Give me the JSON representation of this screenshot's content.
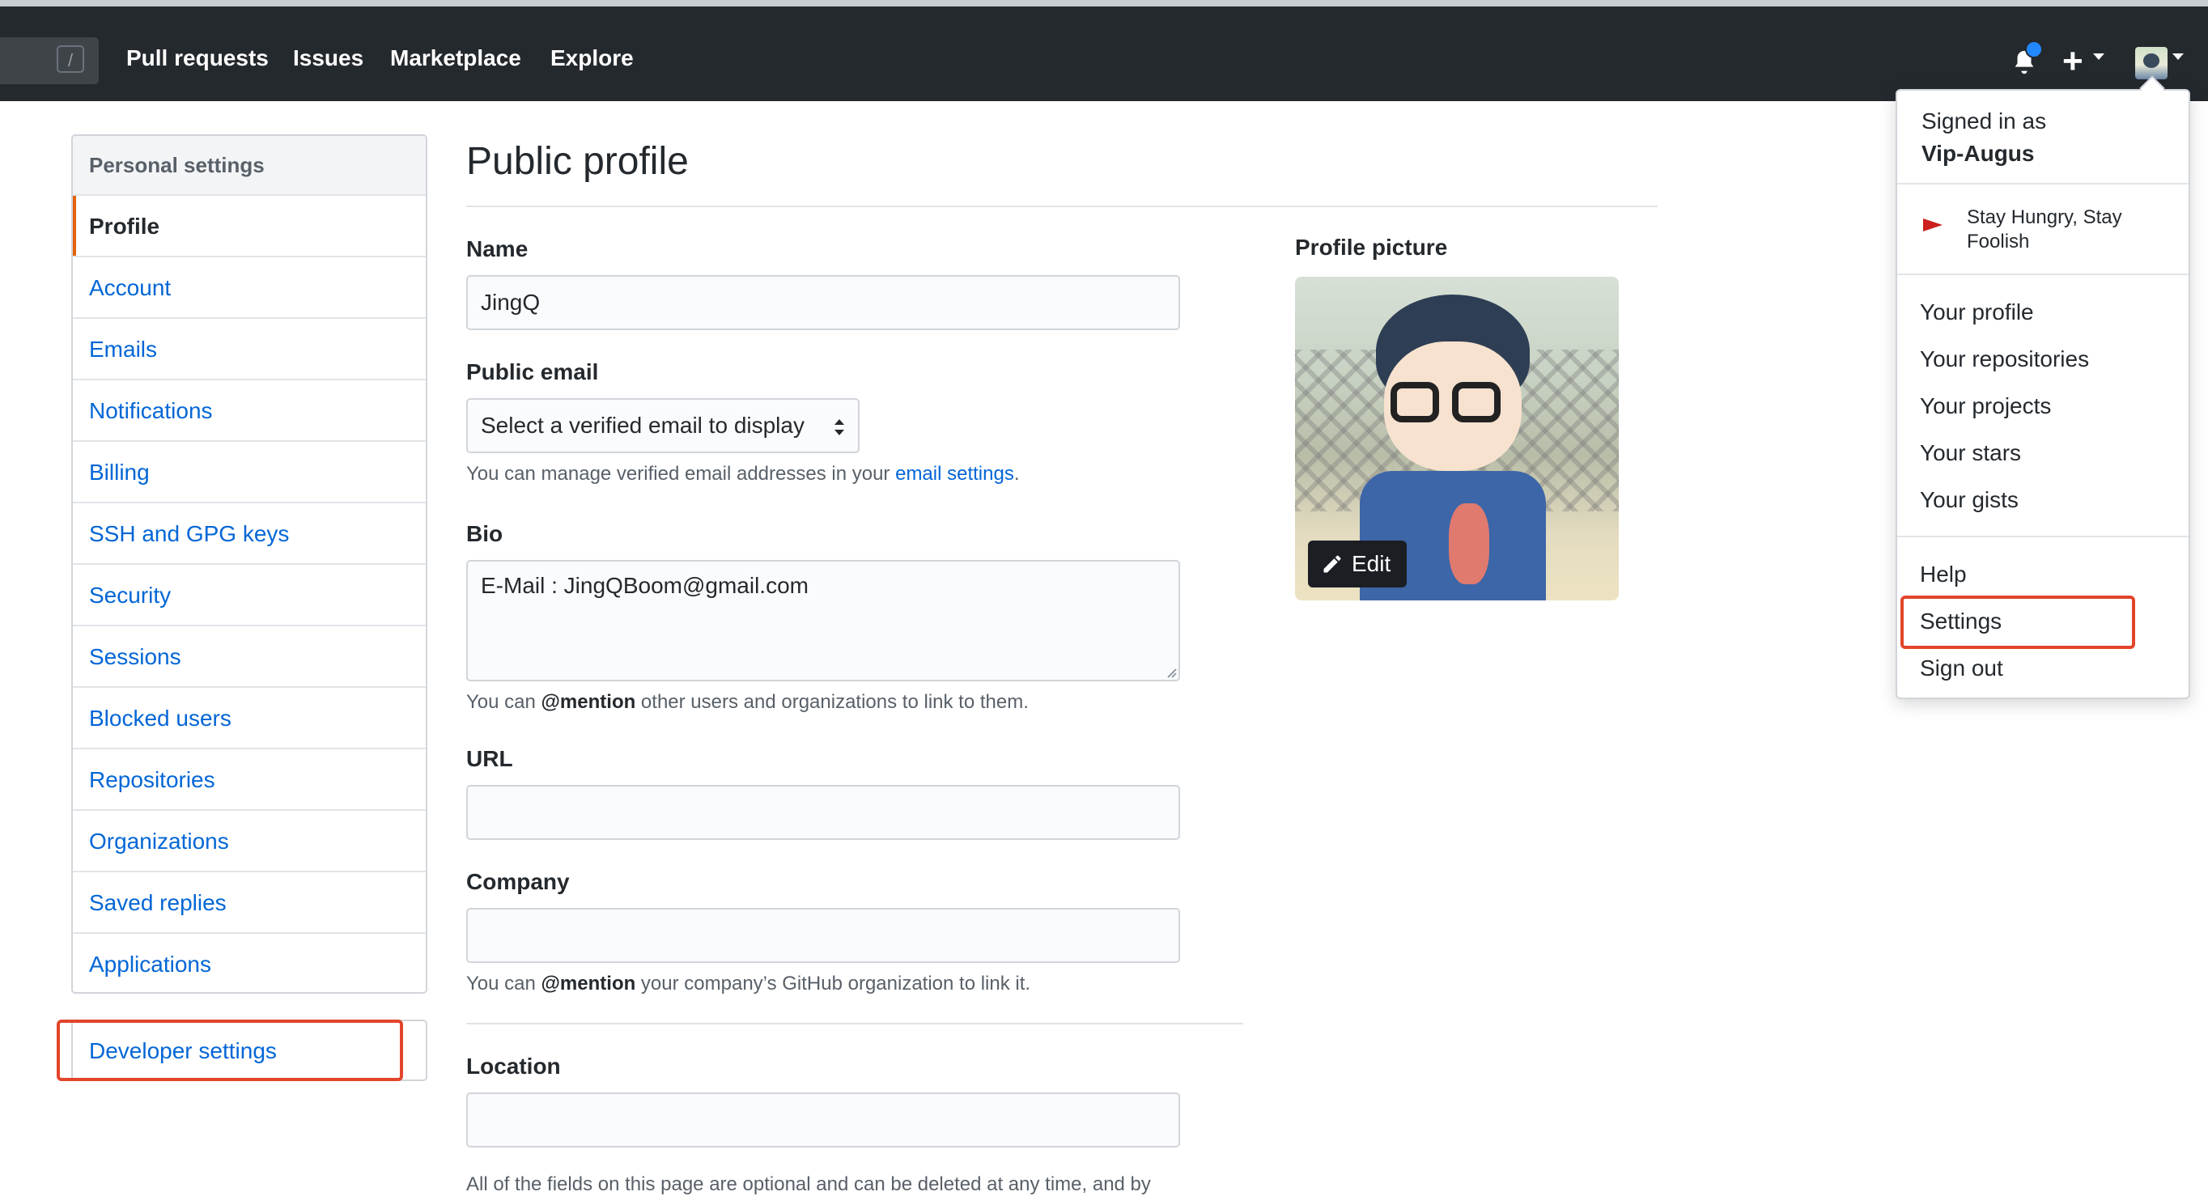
{
  "header": {
    "search_key": "/",
    "nav": [
      "Pull requests",
      "Issues",
      "Marketplace",
      "Explore"
    ]
  },
  "sidebar": {
    "header": "Personal settings",
    "items": [
      "Profile",
      "Account",
      "Emails",
      "Notifications",
      "Billing",
      "SSH and GPG keys",
      "Security",
      "Sessions",
      "Blocked users",
      "Repositories",
      "Organizations",
      "Saved replies",
      "Applications"
    ],
    "active": "Profile",
    "developer_settings": "Developer settings"
  },
  "main": {
    "title": "Public profile",
    "name_label": "Name",
    "name_value": "JingQ",
    "email_label": "Public email",
    "email_select": "Select a verified email to display",
    "email_note_pre": "You can manage verified email addresses in your ",
    "email_note_link": "email settings",
    "email_note_post": ".",
    "bio_label": "Bio",
    "bio_value": "E-Mail : JingQBoom@gmail.com",
    "bio_note_pre": "You can ",
    "bio_note_mention": "@mention",
    "bio_note_post": " other users and organizations to link to them.",
    "url_label": "URL",
    "company_label": "Company",
    "company_note_pre": "You can ",
    "company_note_mention": "@mention",
    "company_note_post": " your company’s GitHub organization to link it.",
    "location_label": "Location",
    "footer_note": "All of the fields on this page are optional and can be deleted at any time, and by"
  },
  "profile_picture": {
    "label": "Profile picture",
    "edit": "Edit"
  },
  "dropdown": {
    "signed_in_as": "Signed in as",
    "username": "Vip-Augus",
    "status": "Stay Hungry, Stay Foolish",
    "items": [
      "Your profile",
      "Your repositories",
      "Your projects",
      "Your stars",
      "Your gists"
    ],
    "help": "Help",
    "settings": "Settings",
    "sign_out": "Sign out"
  },
  "colors": {
    "header_bg": "#24292e",
    "link": "#0366d6",
    "highlight_outline": "#e2452b",
    "active_marker": "#e36209"
  }
}
